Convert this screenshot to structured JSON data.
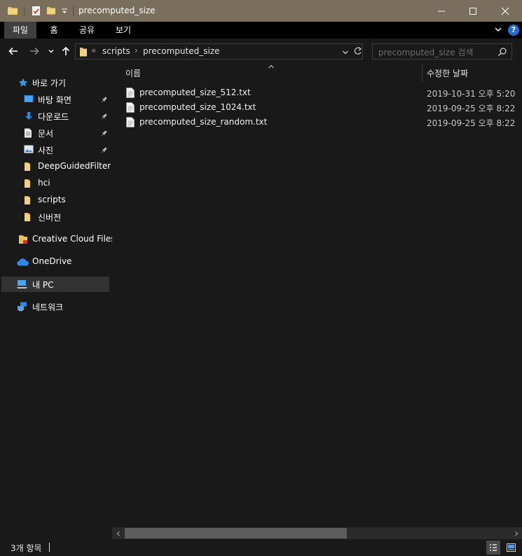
{
  "window": {
    "title": "precomputed_size",
    "buttons": {
      "minimize": "─",
      "maximize": "☐",
      "close": "✕"
    }
  },
  "ribbon": {
    "tabs": [
      {
        "label": "파일",
        "active": true
      },
      {
        "label": "홈",
        "active": false
      },
      {
        "label": "공유",
        "active": false
      },
      {
        "label": "보기",
        "active": false
      }
    ],
    "help": "?"
  },
  "address": {
    "overflow": "«",
    "crumbs": [
      "scripts",
      "precomputed_size"
    ],
    "separator": "›"
  },
  "search": {
    "placeholder": "precomputed_size 검색"
  },
  "sidebar": {
    "quick_access": "바로 가기",
    "items": [
      {
        "label": "바탕 화면",
        "icon": "desktop-icon",
        "pinned": true
      },
      {
        "label": "다운로드",
        "icon": "download-icon",
        "pinned": true
      },
      {
        "label": "문서",
        "icon": "documents-icon",
        "pinned": true
      },
      {
        "label": "사진",
        "icon": "pictures-icon",
        "pinned": true
      },
      {
        "label": "DeepGuidedFiltering",
        "icon": "folder-icon",
        "pinned": false
      },
      {
        "label": "hci",
        "icon": "folder-icon",
        "pinned": false
      },
      {
        "label": "scripts",
        "icon": "folder-icon",
        "pinned": false
      },
      {
        "label": "신버전",
        "icon": "folder-icon",
        "pinned": false
      }
    ],
    "creative_cloud": "Creative Cloud Files",
    "onedrive": "OneDrive",
    "this_pc": "내 PC",
    "network": "네트워크"
  },
  "columns": {
    "name": "이름",
    "modified": "수정한 날짜"
  },
  "files": [
    {
      "name": "precomputed_size_512.txt",
      "modified": "2019-10-31 오후 5:20"
    },
    {
      "name": "precomputed_size_1024.txt",
      "modified": "2019-09-25 오후 8:22"
    },
    {
      "name": "precomputed_size_random.txt",
      "modified": "2019-09-25 오후 8:22"
    }
  ],
  "status": {
    "item_count": "3개 항목"
  },
  "colors": {
    "titlebar": "#7a6f5c",
    "background": "#191919",
    "folder": "#e8c15a",
    "accent_blue": "#1e6fd6"
  }
}
